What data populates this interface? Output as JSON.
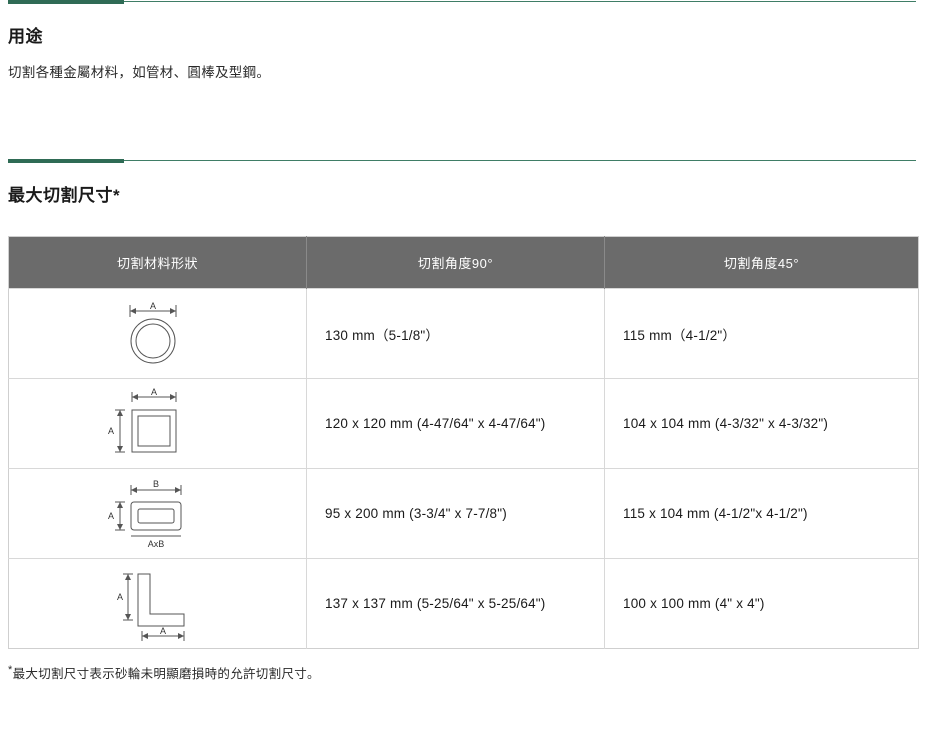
{
  "sections": {
    "usage": {
      "title": "用途",
      "body": "切割各種金屬材料，如管材、圓棒及型鋼。"
    },
    "max_cut": {
      "title": "最大切割尺寸*"
    }
  },
  "table": {
    "headers": [
      "切割材料形狀",
      "切割角度90°",
      "切割角度45°"
    ],
    "rows": [
      {
        "shape": "round-tube-icon",
        "shape_labels": [
          "A"
        ],
        "angle_90": "130 mm（5-1/8\"）",
        "angle_45": "115 mm（4-1/2\"）"
      },
      {
        "shape": "square-tube-icon",
        "shape_labels": [
          "A",
          "A"
        ],
        "angle_90": "120 x 120 mm (4-47/64\" x 4-47/64\")",
        "angle_45": "104 x 104 mm (4-3/32\" x 4-3/32\")"
      },
      {
        "shape": "rectangular-tube-icon",
        "shape_labels": [
          "B",
          "A",
          "AxB"
        ],
        "angle_90": "95 x 200 mm (3-3/4\" x 7-7/8\")",
        "angle_45": "115 x 104 mm (4-1/2\"x 4-1/2\")"
      },
      {
        "shape": "angle-bar-icon",
        "shape_labels": [
          "A",
          "A"
        ],
        "angle_90": "137 x 137 mm (5-25/64\" x 5-25/64\")",
        "angle_45": "100 x 100 mm (4\" x 4\")"
      }
    ]
  },
  "footnote": {
    "star": "*",
    "text": "最大切割尺寸表示砂輪未明顯磨損時的允許切割尺寸。"
  },
  "colors": {
    "accent_bar": "#2f6b55",
    "accent_line": "#3f7d66",
    "header_bg": "#6b6b6b",
    "border": "#d8d8d8"
  }
}
